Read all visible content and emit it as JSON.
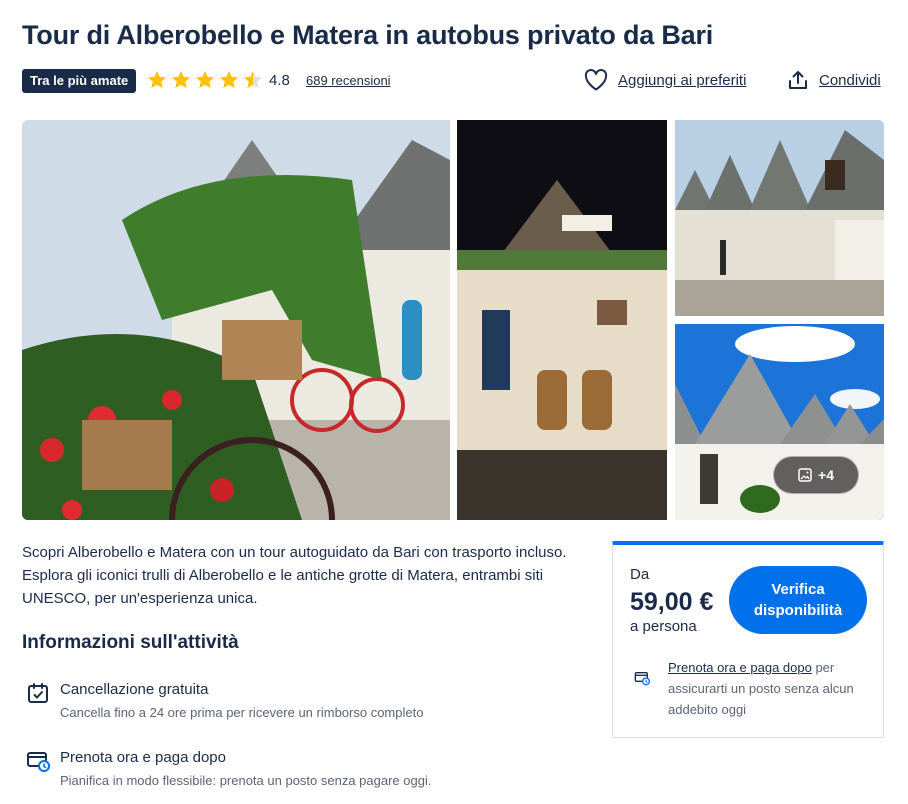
{
  "title": "Tour di Alberobello e Matera in autobus privato da Bari",
  "badge": "Tra le più amate",
  "rating": {
    "value": "4.8",
    "stars_filled": 4.5,
    "stars_total": 5,
    "reviews_label": "689 recensioni"
  },
  "actions": {
    "favorite_label": "Aggiungi ai preferiti",
    "share_label": "Condividi"
  },
  "gallery": {
    "more_label": "+4"
  },
  "description": "Scopri Alberobello e Matera con un tour autoguidato da Bari con trasporto incluso. Esplora gli iconici trulli di Alberobello e le antiche grotte di Matera, entrambi siti UNESCO, per un'esperienza unica.",
  "info": {
    "heading": "Informazioni sull'attività",
    "items": [
      {
        "icon": "calendar-check-icon",
        "title": "Cancellazione gratuita",
        "subtitle": "Cancella fino a 24 ore prima per ricevere un rimborso completo"
      },
      {
        "icon": "card-clock-icon",
        "title": "Prenota ora e paga dopo",
        "subtitle": "Pianifica in modo flessibile: prenota un posto senza pagare oggi."
      }
    ]
  },
  "booking": {
    "from_label": "Da",
    "price": "59,00 €",
    "per_label": "a persona",
    "button_label": "Verifica disponibilità",
    "reserve_link": "Prenota ora e paga dopo",
    "reserve_text": " per assicurarti un posto senza alcun addebito oggi"
  },
  "colors": {
    "primary": "#0071eb",
    "text": "#1a2b49",
    "star": "#ffc107",
    "badge_bg": "#1a2b49"
  }
}
